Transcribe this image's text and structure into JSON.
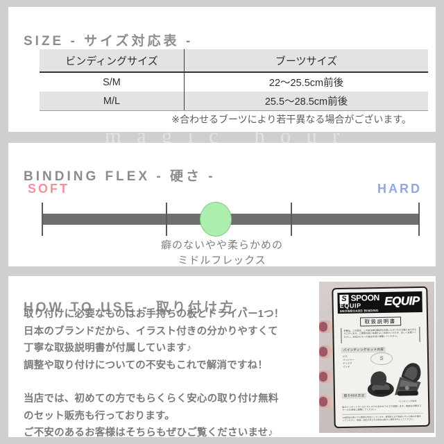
{
  "watermark": {
    "text": "magic hour"
  },
  "size_section": {
    "title": "SIZE - サイズ対応表 -",
    "table": {
      "headers": [
        "ビンディングサイズ",
        "ブーツサイズ"
      ],
      "rows": [
        {
          "binding": "S/M",
          "boot": "22〜25.5cm前後"
        },
        {
          "binding": "M/L",
          "boot": "25.5〜28.5cm前後"
        }
      ]
    },
    "note": "※合わせるブーツにより若干異なる場合がございます。"
  },
  "flex_section": {
    "title": "BINDING FLEX - 硬さ -",
    "soft_label": "SOFT",
    "hard_label": "HARD",
    "soft_color": "#f2909e",
    "hard_color": "#93a6e8",
    "marker_color": "#abeead",
    "bar_color": "#6f6f6f",
    "caption_line1": "癖のないやや柔らかめの",
    "caption_line2": "ミドルフレックス",
    "scale": {
      "min_label": "SOFT",
      "max_label": "HARD",
      "tick_positions_pct": [
        0,
        33,
        66,
        100
      ],
      "marker_position_pct": 46
    }
  },
  "howto_section": {
    "title": "HOW TO USE - 取り付け方 -",
    "paragraph1": "取り付けに必要なものはお手持ちの板とドライバー1つ！\n日本のブランドだから、イラスト付きの分かりやすくて\n丁寧な取扱説明書が付属しています♪\n調整や取り付けについての不安もこれで解消ですね！",
    "paragraph2": "当店では、初めての方でもらくらく安心の取り付け無料\nのセット販売も行っております。\nご不安のあるお客様はそちらもぜひご覧くださいませ♪",
    "photo": {
      "brand_mark": "S",
      "brand_name": "SPOON",
      "brand_sub1": "EQUIP",
      "brand_sub2": "SNOWBOARD BINDING",
      "brand_equip": "EQUIP",
      "doc_title": "取扱説明書",
      "notice_text": "本書は、この度は、この度は弊社製品をお買い上げいただき誠にありがとうございます。ご使用の前に本書をよくお読みいただき、正しくお使いください。お読みになった後は大切に保管してください。",
      "section_label": "バインディングセット内容",
      "parts_text": "ビス\nワッシャー\nディスク\nパッド",
      "logo_ghost": "S",
      "foot_label": "取り付け方法",
      "foot_text": "板のインサートホールにディスクを合わせてビスで固定します。角度は付属のスケールを参考に調整してください。",
      "footer_note": "※本製品は雪上での使用を目的としています。使用前に必ず各部のネジの緩みを確認してください。破損・変形が見られる場合は直ちに使用を中止してください。",
      "binding_caption": "ビンディング本体"
    }
  }
}
